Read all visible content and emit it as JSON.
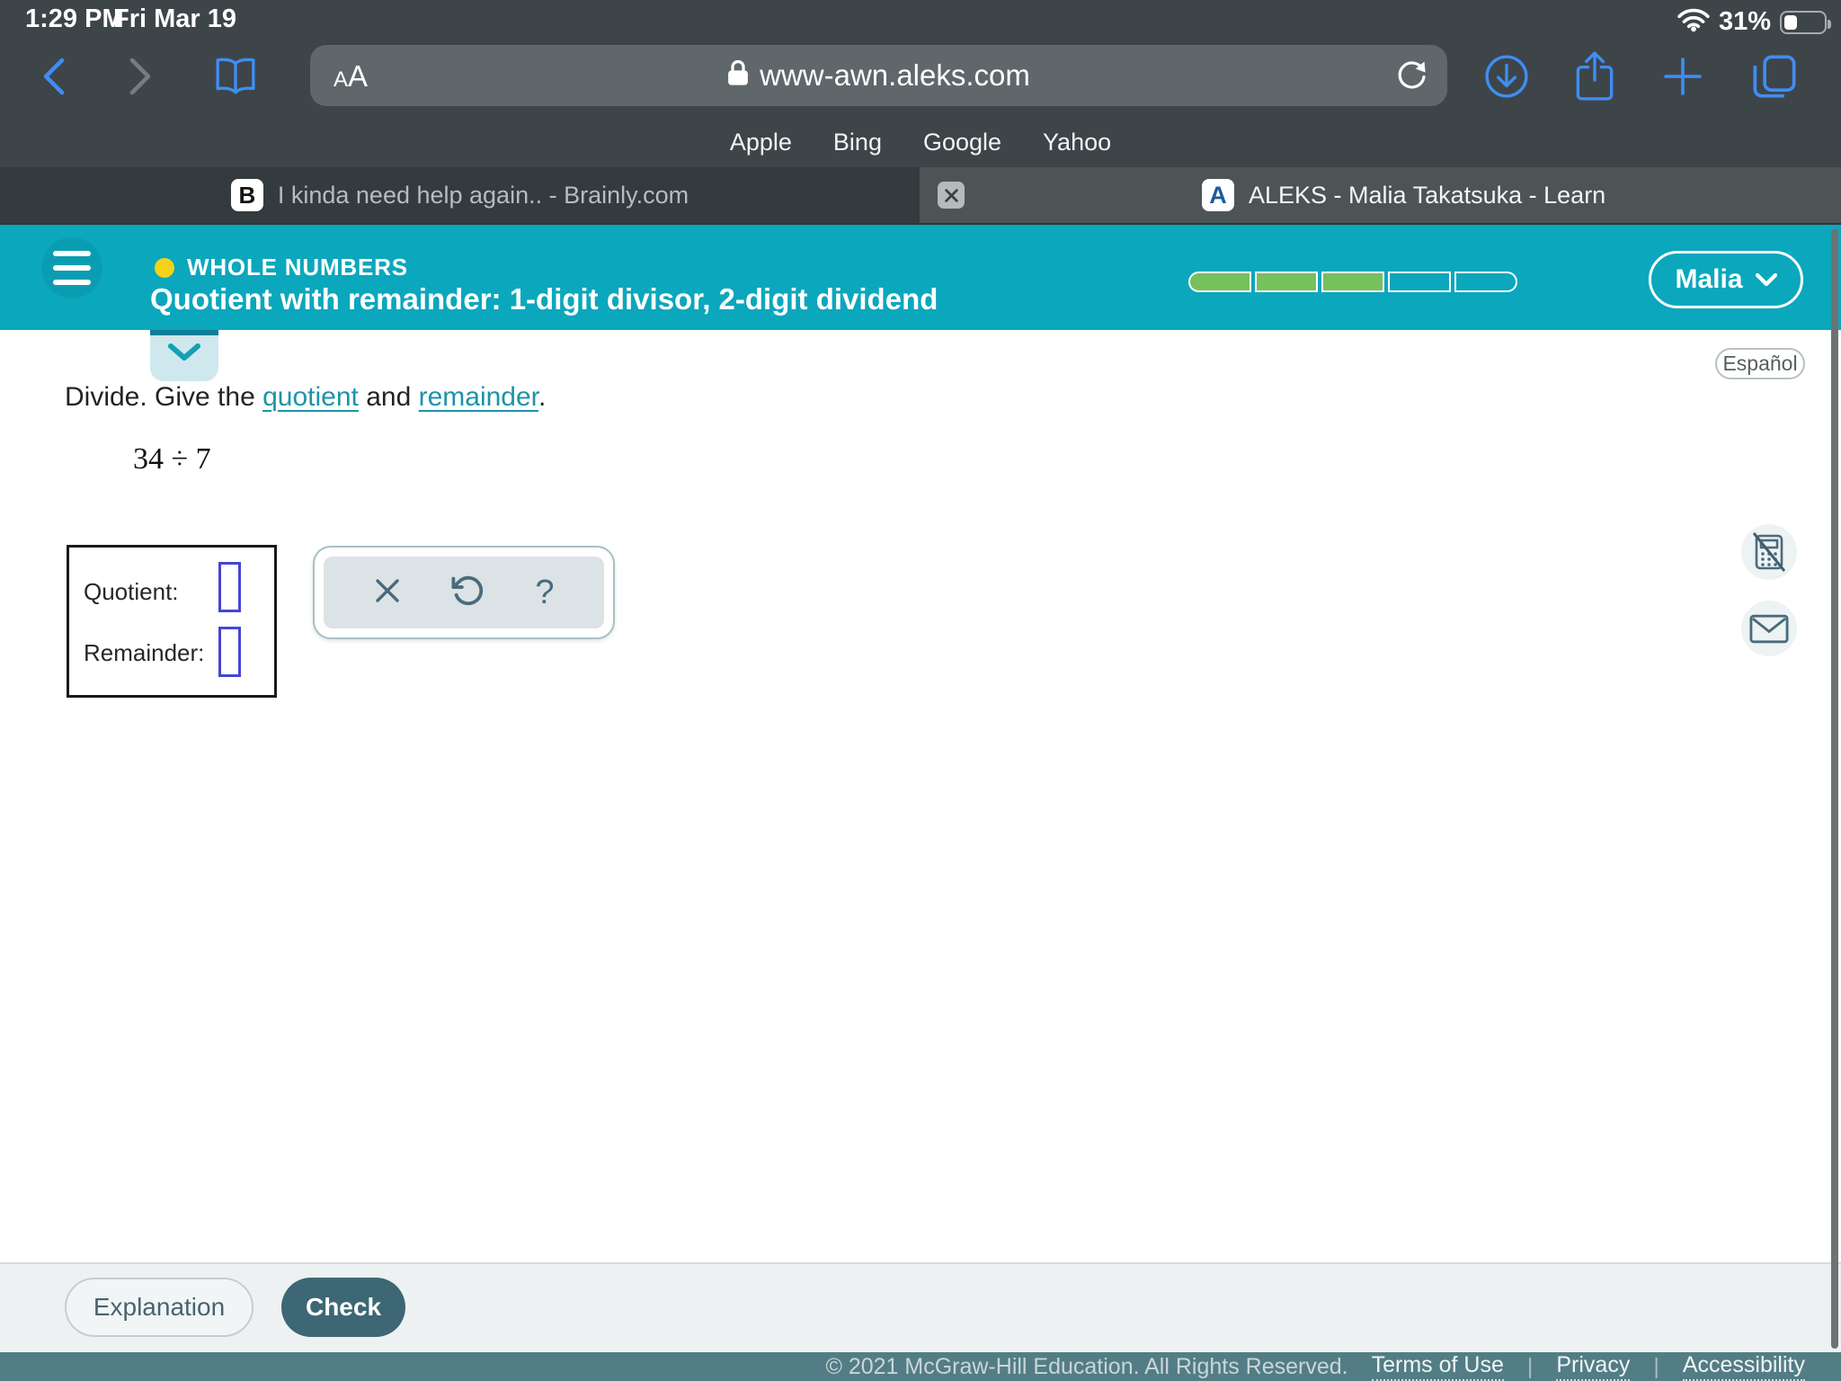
{
  "status_bar": {
    "time": "1:29 PM",
    "date": "Fri Mar 19",
    "battery_percent": "31%"
  },
  "browser": {
    "reader_a_small": "A",
    "reader_a_large": "A",
    "url": "www-awn.aleks.com",
    "shortcuts": [
      "Apple",
      "Bing",
      "Google",
      "Yahoo"
    ],
    "tabs": [
      {
        "favicon_letter": "B",
        "title": "I kinda need help again.. - Brainly.com"
      },
      {
        "favicon_letter": "A",
        "title": "ALEKS - Malia Takatsuka - Learn"
      }
    ]
  },
  "aleks": {
    "category": "WHOLE NUMBERS",
    "lesson_title": "Quotient with remainder: 1-digit divisor, 2-digit dividend",
    "user_name": "Malia",
    "progress": {
      "segments": 5,
      "filled": 3
    },
    "espanol_label": "Español"
  },
  "problem": {
    "prompt_pre": "Divide. Give the ",
    "term_1": "quotient",
    "prompt_mid": " and ",
    "term_2": "remainder",
    "prompt_post": ".",
    "expression": "34 ÷ 7",
    "fields": [
      {
        "label": "Quotient:",
        "value": ""
      },
      {
        "label": "Remainder:",
        "value": ""
      }
    ],
    "toolbar_help_glyph": "?"
  },
  "actions": {
    "explanation_label": "Explanation",
    "check_label": "Check"
  },
  "footer": {
    "copyright": "© 2021 McGraw-Hill Education. All Rights Reserved.",
    "links": [
      "Terms of Use",
      "Privacy",
      "Accessibility"
    ],
    "separator": "|"
  },
  "colors": {
    "aleks_teal": "#0ba7bd",
    "progress_green": "#76c05e",
    "link_teal": "#1d93a8",
    "safari_accent_blue": "#3f8ef4",
    "footer_slate": "#537d85",
    "check_button": "#3d6774",
    "category_dot_yellow": "#f5d219"
  }
}
